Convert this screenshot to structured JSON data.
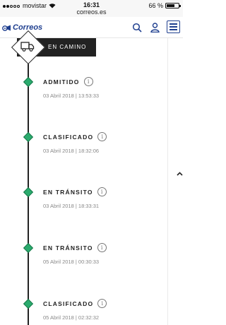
{
  "status_bar": {
    "carrier": "movistar",
    "time": "16:31",
    "battery_text": "66 %",
    "battery_level": 0.66,
    "url": "correos.es"
  },
  "header": {
    "logo_text": "Correos",
    "brand_color": "#1f3f8f",
    "icons": [
      "search-icon",
      "user-icon",
      "menu-icon"
    ]
  },
  "current_status": {
    "label": "EN CAMINO",
    "icon": "truck-icon"
  },
  "events": [
    {
      "title": "ADMITIDO",
      "date": "03 Abril 2018 | 13:53:33"
    },
    {
      "title": "CLASIFICADO",
      "date": "03 Abril 2018 | 18:32:06"
    },
    {
      "title": "EN TRÁNSITO",
      "date": "03 Abril 2018 | 18:33:31"
    },
    {
      "title": "EN TRÁNSITO",
      "date": "05 Abril 2018 | 00:30:33"
    },
    {
      "title": "CLASIFICADO",
      "date": "05 Abril 2018 | 02:32:32"
    }
  ],
  "colors": {
    "event_marker": "#2bab6e",
    "timeline_line": "#222222"
  }
}
